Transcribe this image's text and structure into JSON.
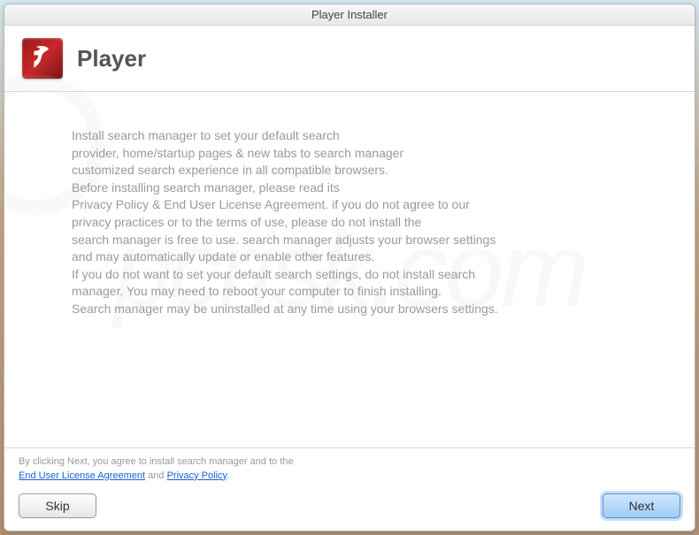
{
  "window": {
    "title": "Player Installer"
  },
  "header": {
    "app_name": "Player"
  },
  "body": {
    "text": "Install search manager to set your default search\nprovider, home/startup pages & new tabs to search manager\ncustomized search experience in all compatible browsers.\nBefore installing search manager, please read its\nPrivacy Policy & End User License Agreement. if you do not agree to our\nprivacy practices or to the terms of use, please do not install the\nsearch manager is free to use. search manager adjusts your browser settings\nand may automatically update or enable other features.\nIf you do not want to set your default search settings, do not install search\nmanager. You may need to reboot your computer to finish installing.\nSearch manager may be uninstalled at any time using your browsers settings."
  },
  "footer": {
    "disclaimer_prefix": "By clicking Next, you agree to install search manager and to the",
    "eula_label": "End User License Agreement",
    "and_label": " and ",
    "privacy_label": "Privacy Policy",
    "period": ".",
    "skip_label": "Skip",
    "next_label": "Next"
  },
  "watermark": "pcrisk.com"
}
